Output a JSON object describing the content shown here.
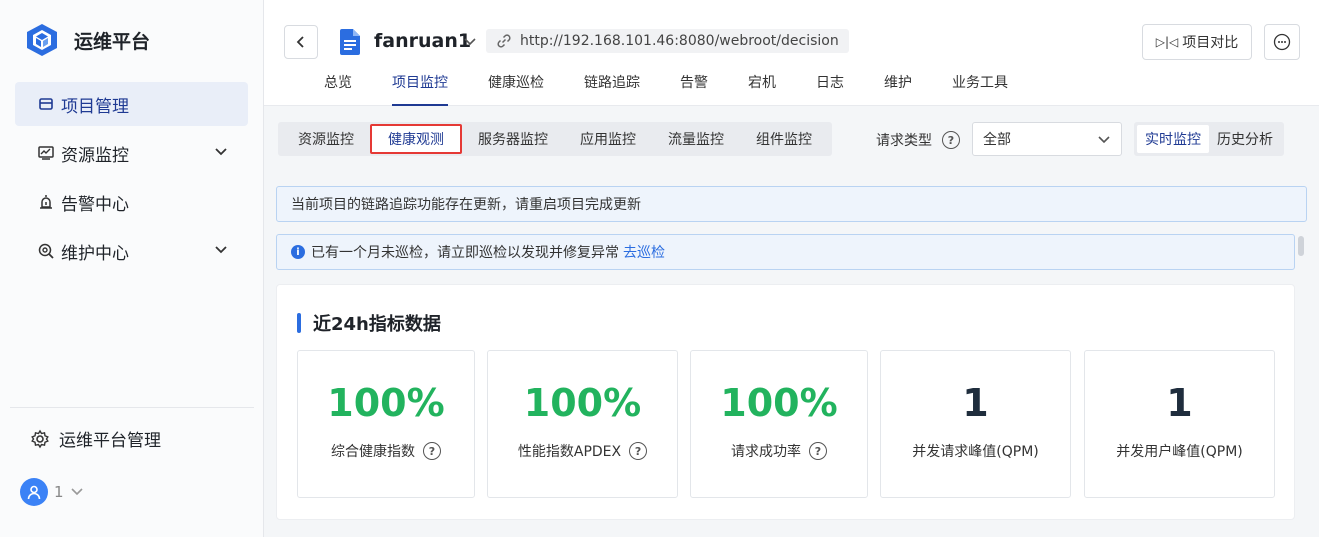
{
  "sidebar": {
    "brand": "运维平台",
    "items": [
      {
        "label": "项目管理"
      },
      {
        "label": "资源监控"
      },
      {
        "label": "告警中心"
      },
      {
        "label": "维护中心"
      }
    ],
    "admin_label": "运维平台管理",
    "user_label": "1"
  },
  "header": {
    "project_name": "fanruan1",
    "url": "http://192.168.101.46:8080/webroot/decision",
    "compare_label": "项目对比",
    "tabs": [
      "总览",
      "项目监控",
      "健康巡检",
      "链路追踪",
      "告警",
      "宕机",
      "日志",
      "维护",
      "业务工具"
    ]
  },
  "subtabs": [
    "资源监控",
    "健康观测",
    "服务器监控",
    "应用监控",
    "流量监控",
    "组件监控"
  ],
  "filter": {
    "label": "请求类型",
    "selected": "全部"
  },
  "mode": {
    "realtime": "实时监控",
    "history": "历史分析"
  },
  "notices": {
    "update": "当前项目的链路追踪功能存在更新，请重启项目完成更新",
    "inspect": "已有一个月未巡检，请立即巡检以发现并修复异常",
    "inspect_link": "去巡检"
  },
  "metrics": {
    "title": "近24h指标数据",
    "cards": [
      {
        "value": "100%",
        "label": "综合健康指数"
      },
      {
        "value": "100%",
        "label": "性能指数APDEX"
      },
      {
        "value": "100%",
        "label": "请求成功率"
      },
      {
        "value": "1",
        "label": "并发请求峰值(QPM)"
      },
      {
        "value": "1",
        "label": "并发用户峰值(QPM)"
      }
    ]
  },
  "colors": {
    "accent": "#1f3a93",
    "link": "#2b6de0",
    "success": "#22b35e",
    "highlight": "#e53935"
  }
}
